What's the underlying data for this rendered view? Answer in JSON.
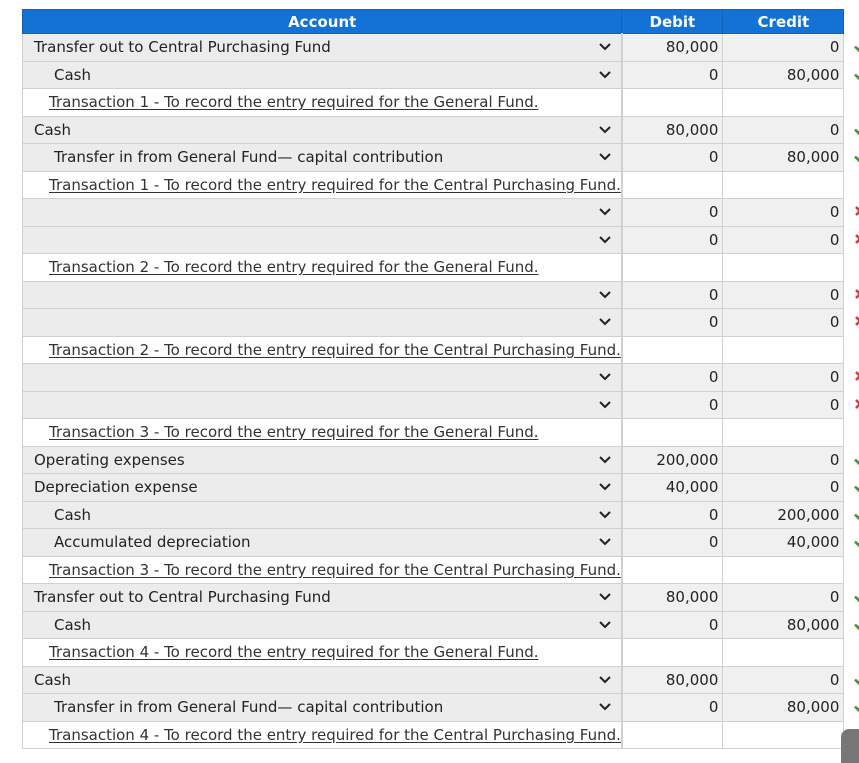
{
  "table": {
    "headers": {
      "account": "Account",
      "debit": "Debit",
      "credit": "Credit"
    },
    "rows": [
      {
        "type": "entry",
        "level": 0,
        "account": "Transfer out to Central Purchasing Fund",
        "debit": "80,000",
        "credit": "0",
        "status": "correct"
      },
      {
        "type": "entry",
        "level": 1,
        "account": "Cash",
        "debit": "0",
        "credit": "80,000",
        "status": "correct"
      },
      {
        "type": "note",
        "account": "Transaction 1 - To record the entry required for the General Fund."
      },
      {
        "type": "entry",
        "level": 0,
        "account": "Cash",
        "debit": "80,000",
        "credit": "0",
        "status": "correct"
      },
      {
        "type": "entry",
        "level": 1,
        "account": "Transfer in from General Fund— capital contribution",
        "debit": "0",
        "credit": "80,000",
        "status": "correct"
      },
      {
        "type": "note",
        "account": "Transaction 1 - To record the entry required for the Central Purchasing Fund."
      },
      {
        "type": "entry",
        "level": 0,
        "account": "",
        "debit": "0",
        "credit": "0",
        "status": "incorrect"
      },
      {
        "type": "entry",
        "level": 0,
        "account": "",
        "debit": "0",
        "credit": "0",
        "status": "incorrect"
      },
      {
        "type": "note",
        "account": "Transaction 2 - To record the entry required for the General Fund."
      },
      {
        "type": "entry",
        "level": 0,
        "account": "",
        "debit": "0",
        "credit": "0",
        "status": "incorrect"
      },
      {
        "type": "entry",
        "level": 0,
        "account": "",
        "debit": "0",
        "credit": "0",
        "status": "incorrect"
      },
      {
        "type": "note",
        "account": "Transaction 2 - To record the entry required for the Central Purchasing Fund."
      },
      {
        "type": "entry",
        "level": 0,
        "account": "",
        "debit": "0",
        "credit": "0",
        "status": "incorrect"
      },
      {
        "type": "entry",
        "level": 0,
        "account": "",
        "debit": "0",
        "credit": "0",
        "status": "incorrect"
      },
      {
        "type": "note",
        "account": "Transaction 3 - To record the entry required for the General Fund."
      },
      {
        "type": "entry",
        "level": 0,
        "account": "Operating expenses",
        "debit": "200,000",
        "credit": "0",
        "status": "correct"
      },
      {
        "type": "entry",
        "level": 0,
        "account": "Depreciation expense",
        "debit": "40,000",
        "credit": "0",
        "status": "correct"
      },
      {
        "type": "entry",
        "level": 1,
        "account": "Cash",
        "debit": "0",
        "credit": "200,000",
        "status": "correct"
      },
      {
        "type": "entry",
        "level": 1,
        "account": "Accumulated depreciation",
        "debit": "0",
        "credit": "40,000",
        "status": "correct"
      },
      {
        "type": "note",
        "account": "Transaction 3 - To record the entry required for the Central Purchasing Fund."
      },
      {
        "type": "entry",
        "level": 0,
        "account": "Transfer out to Central Purchasing Fund",
        "debit": "80,000",
        "credit": "0",
        "status": "correct"
      },
      {
        "type": "entry",
        "level": 1,
        "account": "Cash",
        "debit": "0",
        "credit": "80,000",
        "status": "correct"
      },
      {
        "type": "note",
        "account": "Transaction 4 - To record the entry required for the General Fund."
      },
      {
        "type": "entry",
        "level": 0,
        "account": "Cash",
        "debit": "80,000",
        "credit": "0",
        "status": "correct"
      },
      {
        "type": "entry",
        "level": 1,
        "account": "Transfer in from General Fund— capital contribution",
        "debit": "0",
        "credit": "80,000",
        "status": "correct"
      },
      {
        "type": "note",
        "account": "Transaction 4 - To record the entry required for the Central Purchasing Fund."
      }
    ]
  },
  "icons": {
    "dropdown": "chevron-down-icon",
    "correct": "check-icon",
    "incorrect": "cross-icon"
  },
  "colors": {
    "header": "#1372d6",
    "correct": "#3a9a3a",
    "incorrect": "#d9363e"
  }
}
